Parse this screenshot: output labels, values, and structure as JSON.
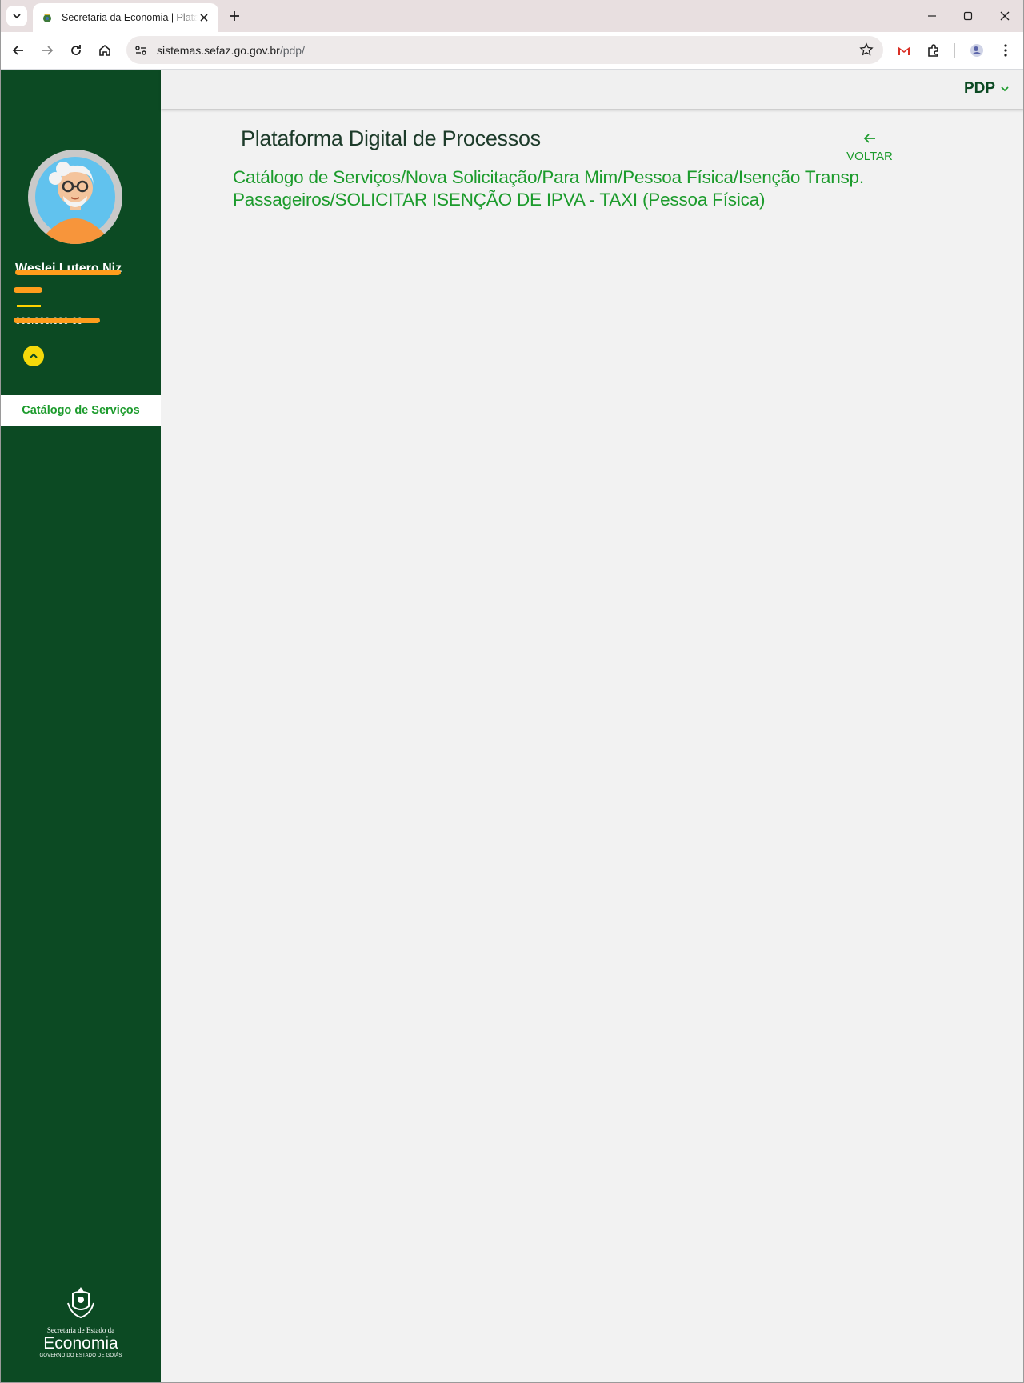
{
  "browser": {
    "tab_title": "Secretaria da Economia | Plataforma Digital de Processos",
    "url_host": "sistemas.sefaz.go.gov.br",
    "url_path": "/pdp/"
  },
  "sidebar": {
    "user_name": "Weslei Lutero Niz",
    "user_document": "000.000.000-00",
    "menu_items": [
      {
        "label": "Catálogo de Serviços"
      }
    ],
    "logo": {
      "line1": "Secretaria de Estado da",
      "line2": "Economia",
      "line3": "GOVERNO DO ESTADO DE GOIÁS"
    }
  },
  "header": {
    "app_menu_label": "PDP"
  },
  "main": {
    "title": "Plataforma Digital de Processos",
    "back_label": "VOLTAR",
    "breadcrumb": "Catálogo de Serviços/Nova Solicitação/Para Mim/Pessoa Física/Isenção Transp. Passageiros/SOLICITAR ISENÇÃO DE IPVA - TAXI (Pessoa Física)"
  },
  "colors": {
    "sidebar_bg": "#0c4a23",
    "accent_green": "#1c9b2c",
    "highlight_yellow": "#f5d90a",
    "redaction_orange": "#ff9d1c"
  }
}
